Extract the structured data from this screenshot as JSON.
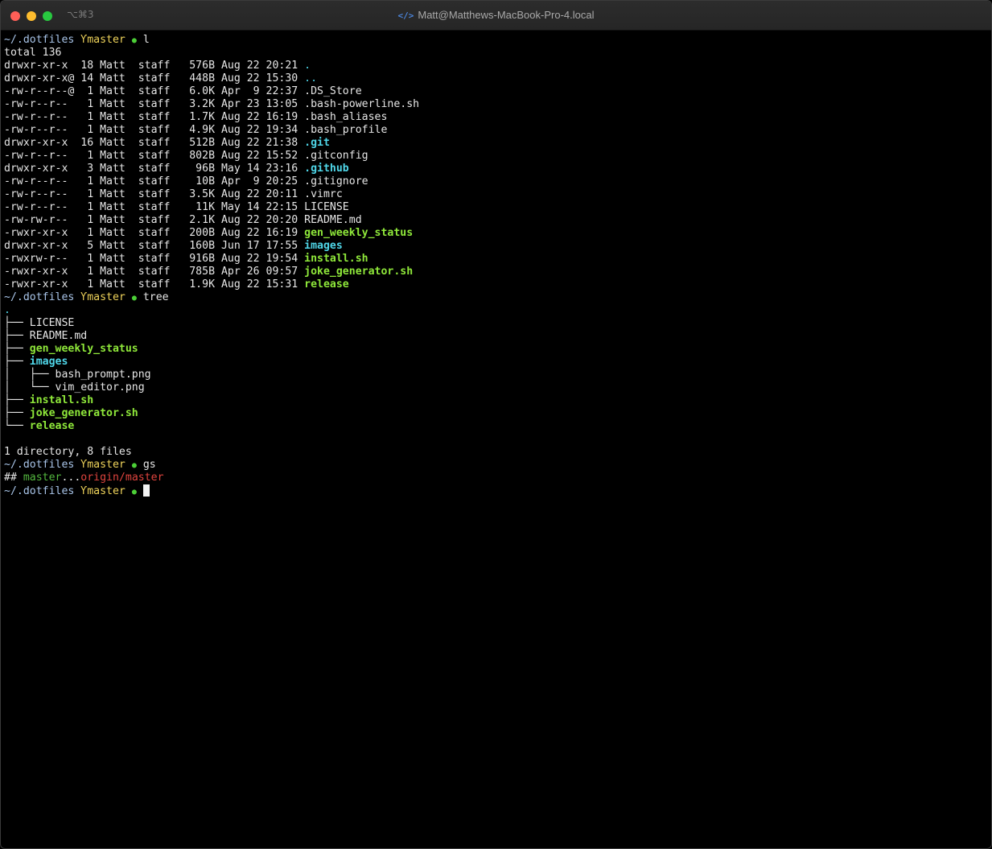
{
  "window": {
    "shortcut": "⌥⌘3",
    "title": "Matt@Matthews-MacBook-Pro-4.local"
  },
  "prompt": {
    "cwd": "~/.dotfiles",
    "branch": "Ƴmaster",
    "apple": "●"
  },
  "commands": {
    "ls": "l",
    "tree": "tree",
    "gs": "gs"
  },
  "ls": {
    "total": "total 136",
    "rows": [
      {
        "meta": "drwxr-xr-x  18 Matt  staff   576B Aug 22 20:21 ",
        "name": ".",
        "kind": "dir"
      },
      {
        "meta": "drwxr-xr-x@ 14 Matt  staff   448B Aug 22 15:30 ",
        "name": "..",
        "kind": "dir"
      },
      {
        "meta": "-rw-r--r--@  1 Matt  staff   6.0K Apr  9 22:37 ",
        "name": ".DS_Store",
        "kind": "file"
      },
      {
        "meta": "-rw-r--r--   1 Matt  staff   3.2K Apr 23 13:05 ",
        "name": ".bash-powerline.sh",
        "kind": "file"
      },
      {
        "meta": "-rw-r--r--   1 Matt  staff   1.7K Aug 22 16:19 ",
        "name": ".bash_aliases",
        "kind": "file"
      },
      {
        "meta": "-rw-r--r--   1 Matt  staff   4.9K Aug 22 19:34 ",
        "name": ".bash_profile",
        "kind": "file"
      },
      {
        "meta": "drwxr-xr-x  16 Matt  staff   512B Aug 22 21:38 ",
        "name": ".git",
        "kind": "dirbold"
      },
      {
        "meta": "-rw-r--r--   1 Matt  staff   802B Aug 22 15:52 ",
        "name": ".gitconfig",
        "kind": "file"
      },
      {
        "meta": "drwxr-xr-x   3 Matt  staff    96B May 14 23:16 ",
        "name": ".github",
        "kind": "dirbold"
      },
      {
        "meta": "-rw-r--r--   1 Matt  staff    10B Apr  9 20:25 ",
        "name": ".gitignore",
        "kind": "file"
      },
      {
        "meta": "-rw-r--r--   1 Matt  staff   3.5K Aug 22 20:11 ",
        "name": ".vimrc",
        "kind": "file"
      },
      {
        "meta": "-rw-r--r--   1 Matt  staff    11K May 14 22:15 ",
        "name": "LICENSE",
        "kind": "file"
      },
      {
        "meta": "-rw-rw-r--   1 Matt  staff   2.1K Aug 22 20:20 ",
        "name": "README.md",
        "kind": "file"
      },
      {
        "meta": "-rwxr-xr-x   1 Matt  staff   200B Aug 22 16:19 ",
        "name": "gen_weekly_status",
        "kind": "exe"
      },
      {
        "meta": "drwxr-xr-x   5 Matt  staff   160B Jun 17 17:55 ",
        "name": "images",
        "kind": "dirbold"
      },
      {
        "meta": "-rwxrw-r--   1 Matt  staff   916B Aug 22 19:54 ",
        "name": "install.sh",
        "kind": "exe"
      },
      {
        "meta": "-rwxr-xr-x   1 Matt  staff   785B Apr 26 09:57 ",
        "name": "joke_generator.sh",
        "kind": "exe"
      },
      {
        "meta": "-rwxr-xr-x   1 Matt  staff   1.9K Aug 22 15:31 ",
        "name": "release",
        "kind": "exe"
      }
    ]
  },
  "tree": {
    "root": ".",
    "rows": [
      {
        "prefix": "├── ",
        "name": "LICENSE",
        "kind": "file"
      },
      {
        "prefix": "├── ",
        "name": "README.md",
        "kind": "file"
      },
      {
        "prefix": "├── ",
        "name": "gen_weekly_status",
        "kind": "exe"
      },
      {
        "prefix": "├── ",
        "name": "images",
        "kind": "dirbold"
      },
      {
        "prefix": "│   ├── ",
        "name": "bash_prompt.png",
        "kind": "file"
      },
      {
        "prefix": "│   └── ",
        "name": "vim_editor.png",
        "kind": "file"
      },
      {
        "prefix": "├── ",
        "name": "install.sh",
        "kind": "exe"
      },
      {
        "prefix": "├── ",
        "name": "joke_generator.sh",
        "kind": "exe"
      },
      {
        "prefix": "└── ",
        "name": "release",
        "kind": "exe"
      }
    ],
    "summary": "1 directory, 8 files"
  },
  "git_status": {
    "hashes": "## ",
    "local": "master",
    "dots": "...",
    "remote": "origin/master"
  }
}
